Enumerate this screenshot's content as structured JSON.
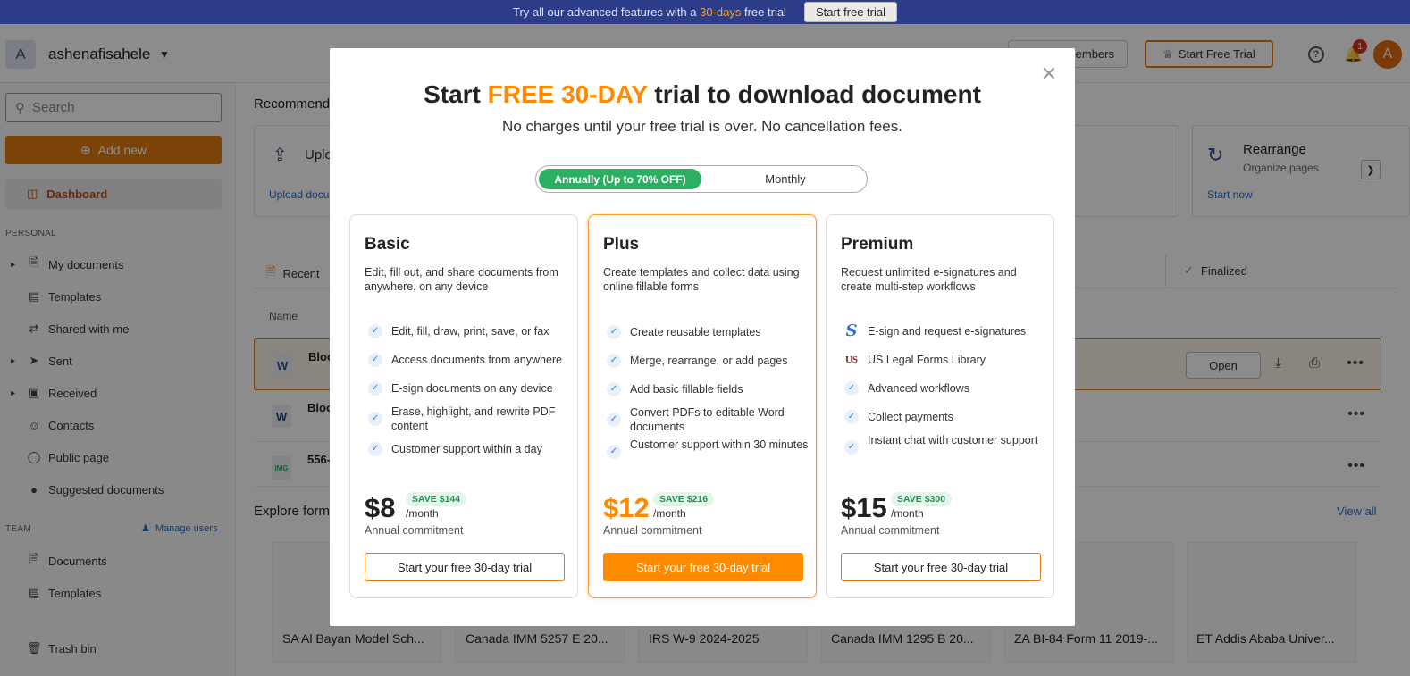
{
  "banner": {
    "text_a": "Try all our advanced features with a",
    "highlight": "30-days",
    "text_b": "free trial",
    "button": "Start free trial"
  },
  "header": {
    "workspace_initial": "A",
    "workspace_name": "ashenafisahele",
    "members_label": "embers",
    "start_trial": "Start Free Trial",
    "notification_count": "1",
    "user_initial": "A"
  },
  "sidebar": {
    "search_placeholder": "Search",
    "add_new": "Add new",
    "dashboard": "Dashboard",
    "personal_label": "PERSONAL",
    "personal_items": [
      {
        "label": "My documents",
        "icon": "document-icon"
      },
      {
        "label": "Templates",
        "icon": "template-icon"
      },
      {
        "label": "Shared with me",
        "icon": "share-icon"
      },
      {
        "label": "Sent",
        "icon": "send-icon"
      },
      {
        "label": "Received",
        "icon": "inbox-icon"
      },
      {
        "label": "Contacts",
        "icon": "contacts-icon"
      },
      {
        "label": "Public page",
        "icon": "globe-icon"
      },
      {
        "label": "Suggested documents",
        "icon": "bulb-icon"
      }
    ],
    "team_label": "TEAM",
    "manage_users": "Manage users",
    "team_items": [
      {
        "label": "Documents",
        "icon": "document-icon"
      },
      {
        "label": "Templates",
        "icon": "template-icon"
      }
    ],
    "trash": "Trash bin"
  },
  "main": {
    "recommended_title": "Recommend",
    "upload_title": "Uplo",
    "upload_link": "Upload docu",
    "card_frag": "s",
    "rearrange_title": "Rearrange",
    "rearrange_sub": "Organize pages",
    "rearrange_link": "Start now",
    "tabs": {
      "recent": "Recent",
      "finalized": "Finalized"
    },
    "col_name": "Name",
    "rows": [
      {
        "icon": "W",
        "name": "Bloc"
      },
      {
        "icon": "W",
        "name": "Bloc"
      },
      {
        "icon": "IMG",
        "name": "556-"
      }
    ],
    "open_label": "Open",
    "explore_title": "Explore form",
    "view_all": "View all",
    "forms": [
      "SA Al Bayan Model Sch...",
      "Canada IMM 5257 E 20...",
      "IRS W-9 2024-2025",
      "Canada IMM 1295 B 20...",
      "ZA BI-84 Form 11 2019-...",
      "ET Addis Ababa Univer..."
    ]
  },
  "modal": {
    "title_a": "Start",
    "title_hl": "FREE 30-DAY",
    "title_b": "trial to download document",
    "subtitle": "No charges until your free trial is over. No cancellation fees.",
    "toggle_annual": "Annually (Up to 70% OFF)",
    "toggle_monthly": "Monthly",
    "plans": [
      {
        "name": "Basic",
        "desc": "Edit, fill out, and share documents from anywhere, on any device",
        "features": [
          "Edit, fill, draw, print, save, or fax",
          "Access documents from anywhere",
          "E-sign documents on any device",
          "Erase, highlight, and rewrite PDF content",
          "Customer support within a day"
        ],
        "price": "$8",
        "save": "SAVE $144",
        "per": "/month",
        "commit": "Annual commitment",
        "cta": "Start your free 30-day trial"
      },
      {
        "name": "Plus",
        "desc": "Create templates and collect data using online fillable forms",
        "features": [
          "Create reusable templates",
          "Merge, rearrange, or add pages",
          "Add basic fillable fields",
          "Convert PDFs to editable Word documents",
          "Customer support within 30 minutes"
        ],
        "price": "$12",
        "save": "SAVE $216",
        "per": "/month",
        "commit": "Annual commitment",
        "cta": "Start your free 30-day trial"
      },
      {
        "name": "Premium",
        "desc": "Request unlimited e-signatures and create multi-step workflows",
        "features": [
          "E-sign and request e-signatures",
          "US Legal Forms Library",
          "Advanced workflows",
          "Collect payments",
          "Instant chat with customer support"
        ],
        "price": "$15",
        "save": "SAVE $300",
        "per": "/month",
        "commit": "Annual commitment",
        "cta": "Start your free 30-day trial"
      }
    ]
  },
  "colors": {
    "accent": "#ff8a00",
    "brand_blue": "#2d3d8a",
    "toggle_green": "#2bb063"
  }
}
